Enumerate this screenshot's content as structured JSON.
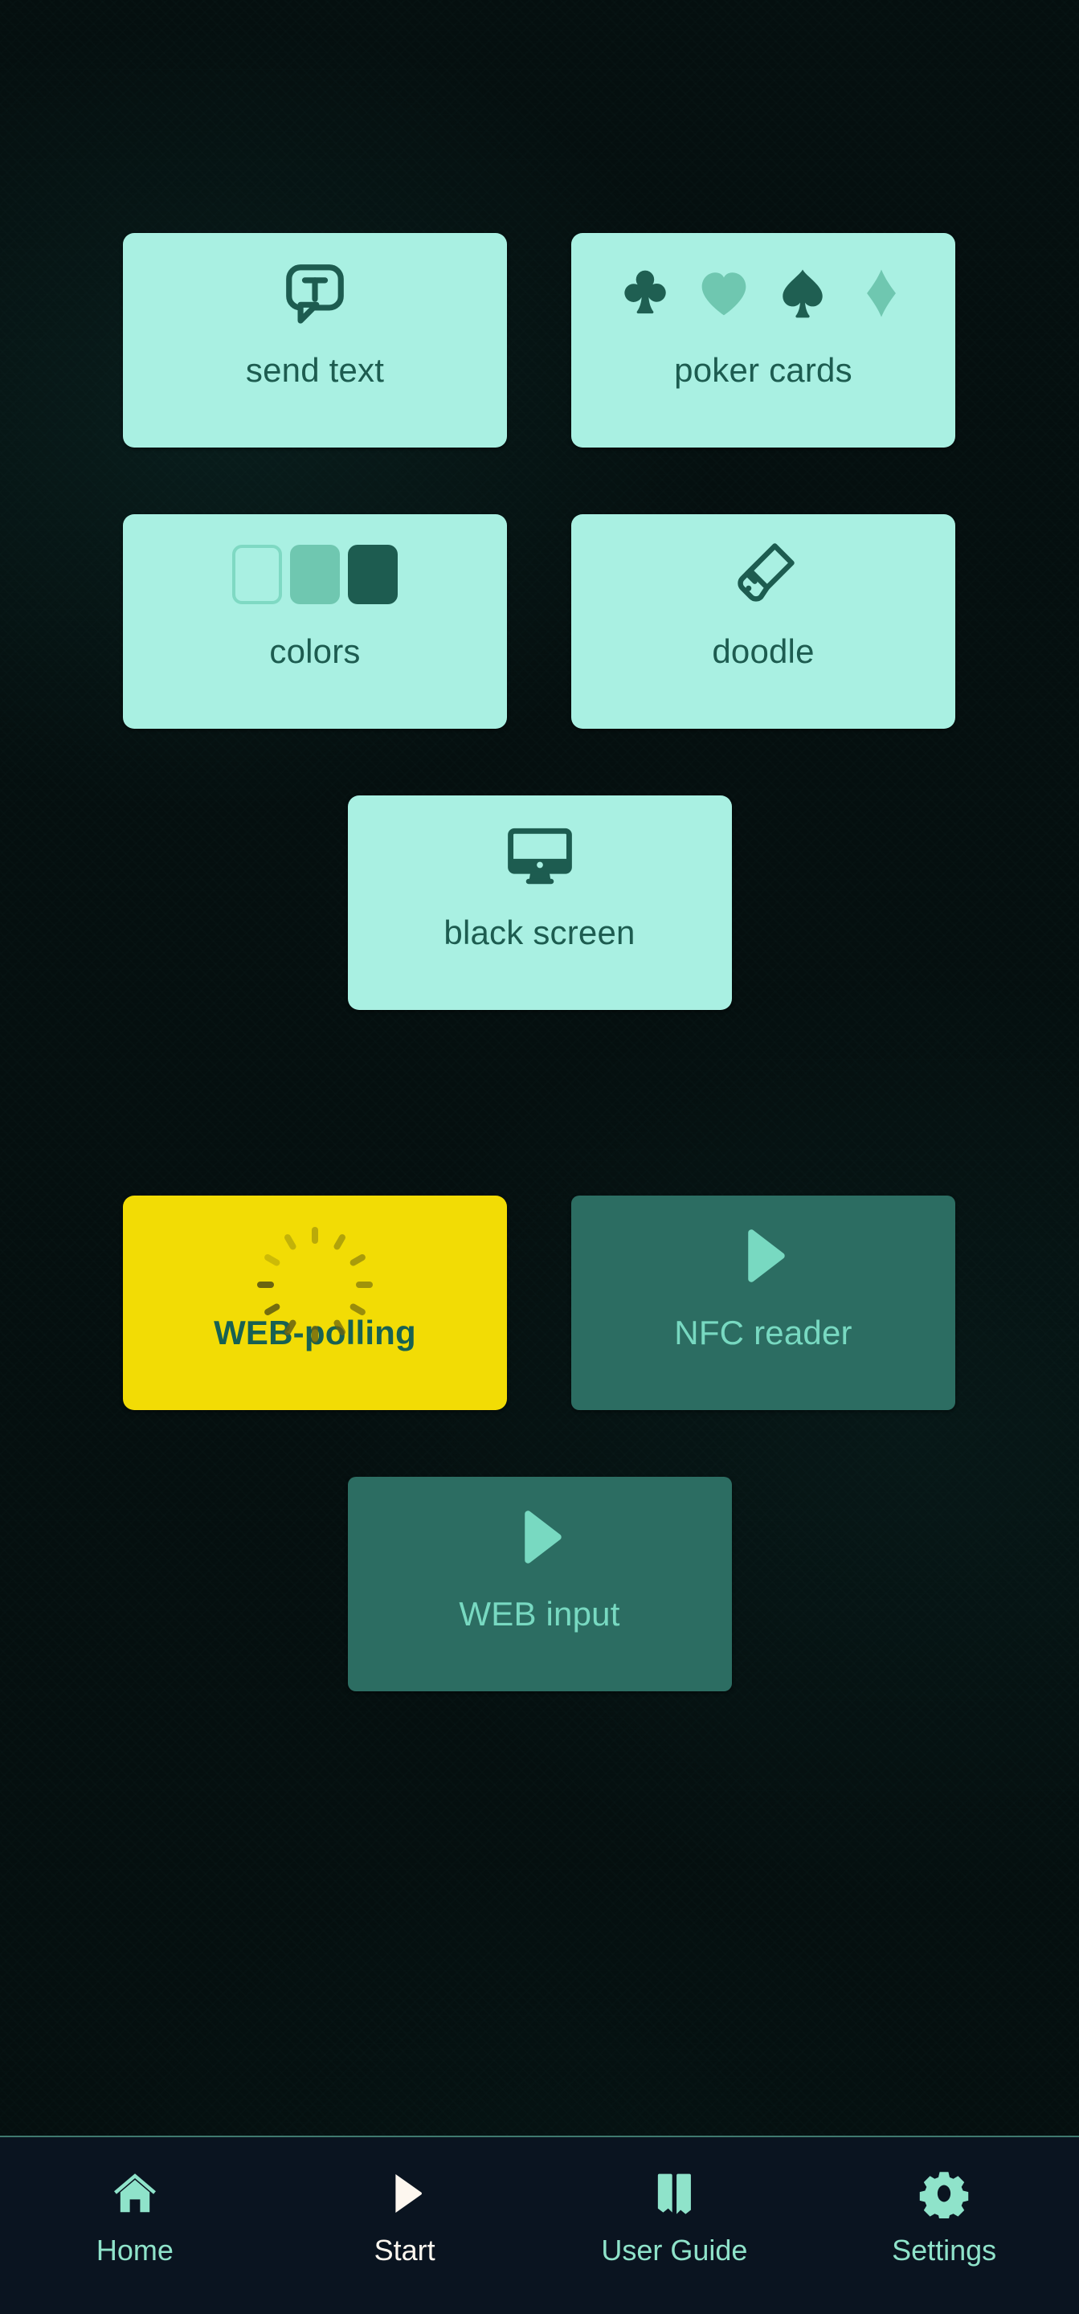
{
  "theme": {
    "background": "#050f0f",
    "card_mint": "#a9f0e2",
    "card_yellow": "#f2dc05",
    "card_teal": "#2c6d62",
    "text_dark_teal": "#1d5c50",
    "text_light_teal": "#78d9c1",
    "nav_background": "#0a1420",
    "nav_border": "#3f7a6f",
    "nav_icon_teal": "#8fe3ca",
    "nav_active_white": "#fdf7ef",
    "suit_dark": "#1f5f52",
    "suit_light": "#6fc7b0"
  },
  "grid": {
    "rows": [
      {
        "cards": [
          {
            "id": "send-text",
            "label": "send text",
            "icon": "speech-bubble-text-icon",
            "style": "mint"
          },
          {
            "id": "poker-cards",
            "label": "poker cards",
            "icon": "playing-card-suits-icon",
            "style": "mint"
          }
        ]
      },
      {
        "cards": [
          {
            "id": "colors",
            "label": "colors",
            "icon": "color-swatches-icon",
            "style": "mint"
          },
          {
            "id": "doodle",
            "label": "doodle",
            "icon": "paint-brush-icon",
            "style": "mint"
          }
        ]
      },
      {
        "centered": true,
        "cards": [
          {
            "id": "black-screen",
            "label": "black screen",
            "icon": "monitor-icon",
            "style": "mint"
          }
        ]
      },
      {
        "spacer": true
      },
      {
        "cards": [
          {
            "id": "web-polling",
            "label": "WEB-polling",
            "icon": "loading-spinner-icon",
            "style": "yellow"
          },
          {
            "id": "nfc-reader",
            "label": "NFC reader",
            "icon": "play-triangle-icon",
            "style": "teal"
          }
        ]
      },
      {
        "centered": true,
        "cards": [
          {
            "id": "web-input",
            "label": "WEB input",
            "icon": "play-triangle-icon",
            "style": "teal"
          }
        ]
      }
    ]
  },
  "navbar": {
    "items": [
      {
        "id": "home",
        "label": "Home",
        "icon": "home-icon",
        "active": false
      },
      {
        "id": "start",
        "label": "Start",
        "icon": "play-icon",
        "active": true
      },
      {
        "id": "user-guide",
        "label": "User Guide",
        "icon": "open-book-icon",
        "active": false
      },
      {
        "id": "settings",
        "label": "Settings",
        "icon": "gear-icon",
        "active": false
      }
    ]
  }
}
